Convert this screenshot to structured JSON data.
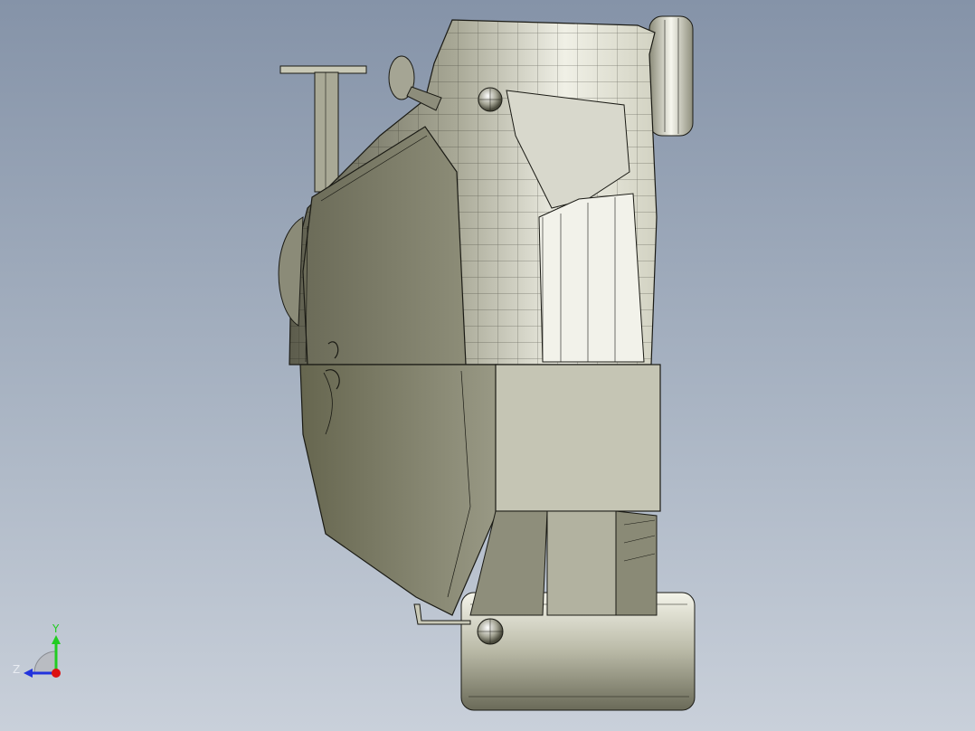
{
  "viewport": {
    "background_top": "#8593a8",
    "background_bottom": "#c9d0da",
    "model_shade": "#c9c9b8",
    "model_dark": "#707060",
    "edge_color": "#1a1a14"
  },
  "triad": {
    "y_label": "Y",
    "z_label": "Z",
    "y_color": "#22cc22",
    "z_color": "#2233dd",
    "x_color": "#dd1111",
    "icon": "coordinate-triad-icon"
  }
}
